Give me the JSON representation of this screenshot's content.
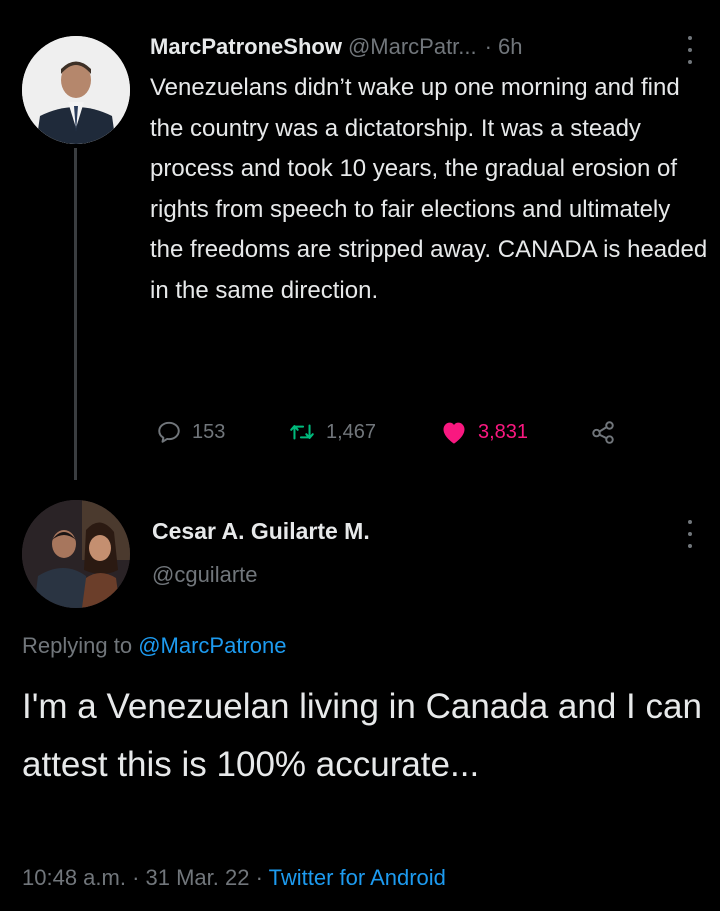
{
  "tweet": {
    "author_name": "MarcPatroneShow",
    "author_handle": "@MarcPatr...",
    "separator": "·",
    "time": "6h",
    "body": "Venezuelans didn’t wake up one morning and find the country was a dictatorship. It was a steady process and took 10 years, the gradual erosion of rights from speech to fair elections and ultimately the freedoms are stripped away. CANADA is headed in the same direction.",
    "replies": "153",
    "retweets": "1,467",
    "likes": "3,831",
    "icons": {
      "reply": "reply-icon",
      "retweet": "retweet-icon",
      "like": "heart-icon",
      "share": "share-icon",
      "more": "more-vertical-icon"
    },
    "colors": {
      "like": "#f91880",
      "retweet": "#00ba7c"
    }
  },
  "reply": {
    "author_name": "Cesar A. Guilarte M.",
    "author_handle": "@cguilarte",
    "replying_prefix": "Replying to ",
    "replying_to": "@MarcPatrone",
    "body": "I'm a Venezuelan living in Canada and I can attest this is 100% accurate...",
    "timestamp": "10:48 a.m. · 31 Mar. 22 · ",
    "source": "Twitter for Android",
    "colors": {
      "link": "#1d9bf0"
    }
  }
}
